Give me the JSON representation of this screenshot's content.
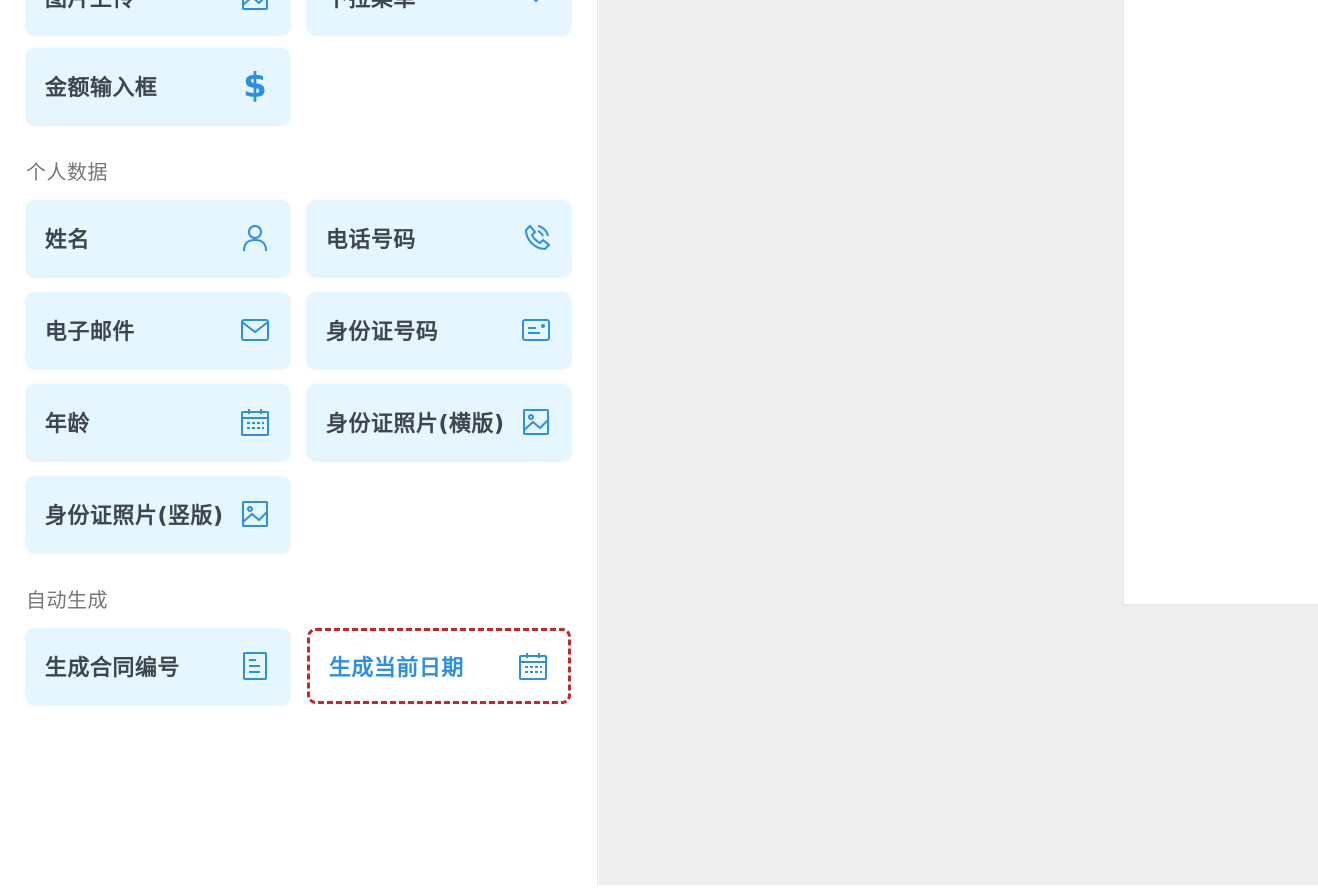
{
  "top_partial": {
    "left_label": "图片上传",
    "right_label": "下拉菜单"
  },
  "basic": {
    "amount_input": {
      "label": "金额输入框",
      "icon": "dollar-icon",
      "glyph": "$"
    }
  },
  "personal": {
    "title": "个人数据",
    "items": [
      {
        "label": "姓名",
        "icon": "person-icon"
      },
      {
        "label": "电话号码",
        "icon": "phone-icon"
      },
      {
        "label": "电子邮件",
        "icon": "envelope-icon"
      },
      {
        "label": "身份证号码",
        "icon": "id-card-icon"
      },
      {
        "label": "年龄",
        "icon": "calendar-icon"
      },
      {
        "label": "身份证照片(横版)",
        "icon": "image-icon"
      },
      {
        "label": "身份证照片(竖版)",
        "icon": "image-icon"
      }
    ]
  },
  "auto": {
    "title": "自动生成",
    "items": [
      {
        "label": "生成合同编号",
        "icon": "document-icon"
      },
      {
        "label": "生成当前日期",
        "icon": "calendar-icon",
        "selected": true
      }
    ]
  },
  "colors": {
    "accent": "#2d8fe0",
    "card_bg": "#e6f6fe",
    "selected_border": "#c8242c",
    "canvas_bg": "#eeeeee"
  }
}
